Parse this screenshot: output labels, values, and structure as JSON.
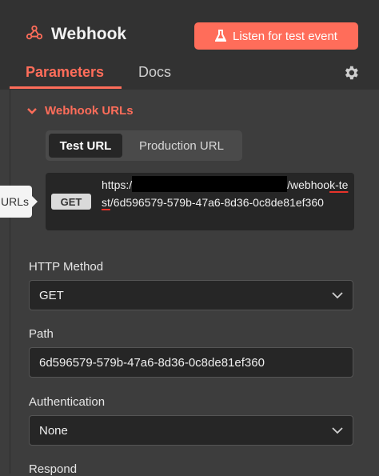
{
  "header": {
    "title": "Webhook",
    "listen_label": "Listen for test event"
  },
  "tabs": [
    {
      "label": "Parameters",
      "active": true
    },
    {
      "label": "Docs",
      "active": false
    }
  ],
  "section": {
    "title": "Webhook URLs",
    "toggle": {
      "test_label": "Test URL",
      "production_label": "Production URL",
      "selected": "Test URL"
    },
    "url": {
      "method": "GET",
      "prefix": "https:/",
      "after_redaction": "/webhoo",
      "highlighted": "k-test",
      "suffix": "/6d596579-579b-47a6-8d36-0c8de81ef360"
    },
    "tooltip": "URLs"
  },
  "fields": {
    "http_method": {
      "label": "HTTP Method",
      "value": "GET"
    },
    "path": {
      "label": "Path",
      "value": "6d596579-579b-47a6-8d36-0c8de81ef360"
    },
    "authentication": {
      "label": "Authentication",
      "value": "None"
    },
    "respond": {
      "label": "Respond"
    }
  },
  "colors": {
    "accent": "#ff6d5a",
    "background": "#3d3d3d",
    "input": "#262626"
  }
}
